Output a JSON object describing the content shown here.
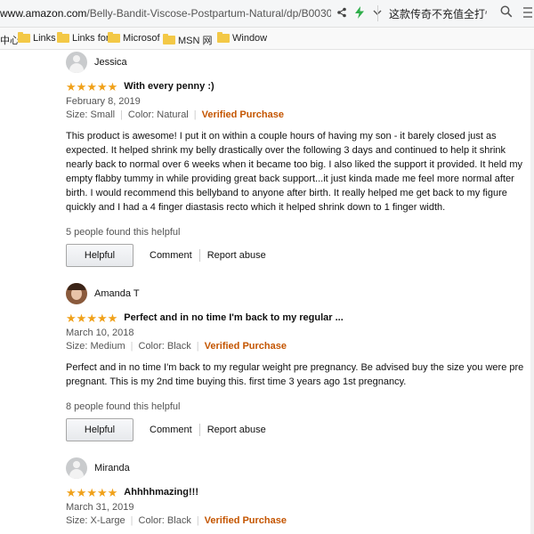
{
  "browser": {
    "url_prefix": "www.amazon.com",
    "url_path": "/Belly-Bandit-Viscose-Postpartum-Natural/dp/B0030",
    "search_text": "这款传奇不充值全打怪"
  },
  "bookmarks": [
    {
      "label": "中心",
      "folder": false
    },
    {
      "label": "Links",
      "folder": true
    },
    {
      "label": "Links for",
      "folder": true
    },
    {
      "label": "Microsof",
      "folder": true
    },
    {
      "label": "MSN 网",
      "folder": true
    },
    {
      "label": "Window",
      "folder": true
    }
  ],
  "colors": {
    "star": "#f0a11a",
    "verified": "#c45500"
  },
  "reviews": [
    {
      "reviewer": "Jessica",
      "avatar": "default-avatar",
      "rating": 5,
      "title": "With every penny :)",
      "date": "February 8, 2019",
      "size": "Size: Small",
      "color": "Color: Natural",
      "verified": "Verified Purchase",
      "body": "This product is awesome! I put it on within a couple hours of having my son - it barely closed just as expected. It helped shrink my belly drastically over the following 3 days and continued to help it shrink nearly back to normal over 6 weeks when it became too big. I also liked the support it provided. It held my empty flabby tummy in while providing great back support...it just kinda made me feel more normal after birth. I would recommend this bellyband to anyone after birth. It really helped me get back to my figure quickly and I had a 4 finger diastasis recto which it helped shrink down to 1 finger width.",
      "helpful_count": "5 people found this helpful",
      "helpful_label": "Helpful",
      "comment_label": "Comment",
      "report_label": "Report abuse"
    },
    {
      "reviewer": "Amanda T",
      "avatar": "photo-avatar",
      "rating": 5,
      "title": "Perfect and in no time I'm back to my regular ...",
      "date": "March 10, 2018",
      "size": "Size: Medium",
      "color": "Color: Black",
      "verified": "Verified Purchase",
      "body": "Perfect and in no time I'm back to my regular weight pre pregnancy. Be advised buy the size you were pre pregnant. This is my 2nd time buying this. first time 3 years ago 1st pregnancy.",
      "helpful_count": "8 people found this helpful",
      "helpful_label": "Helpful",
      "comment_label": "Comment",
      "report_label": "Report abuse"
    },
    {
      "reviewer": "Miranda",
      "avatar": "default-avatar",
      "rating": 5,
      "title": "Ahhhhmazing!!!",
      "date": "March 31, 2019",
      "size": "Size: X-Large",
      "color": "Color: Black",
      "verified": "Verified Purchase"
    }
  ]
}
